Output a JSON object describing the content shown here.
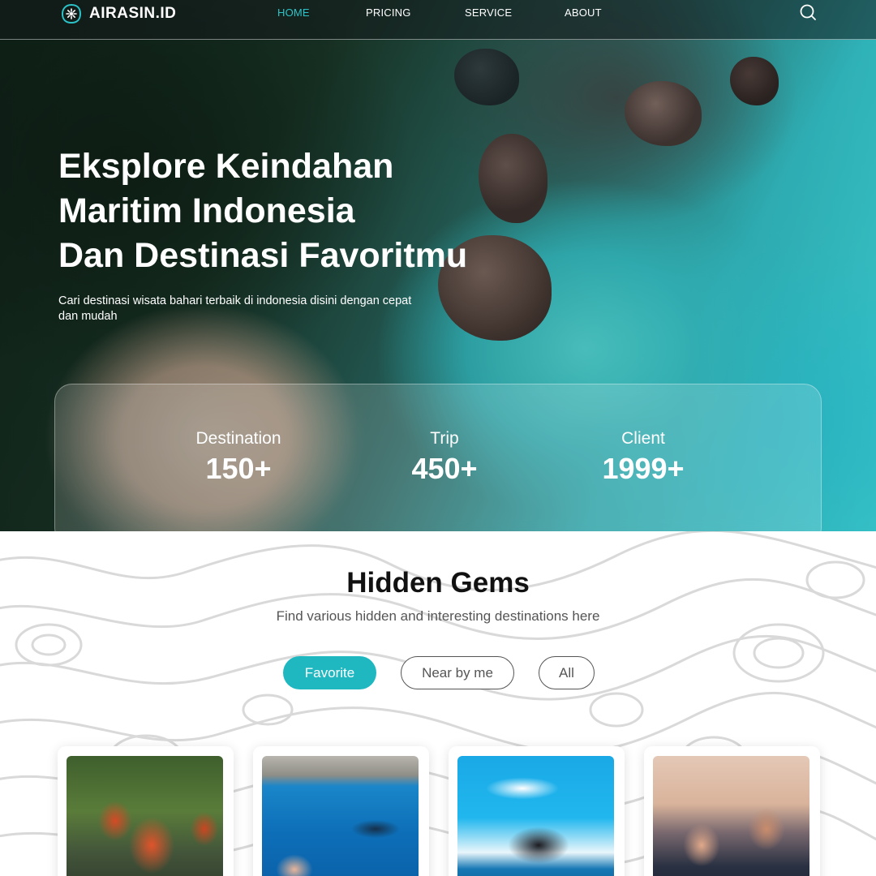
{
  "brand": {
    "name": "AIRASIN.ID",
    "accent": "#2cc4c9"
  },
  "nav": {
    "items": [
      {
        "label": "HOME",
        "active": true
      },
      {
        "label": "PRICING",
        "active": false
      },
      {
        "label": "SERVICE",
        "active": false
      },
      {
        "label": "ABOUT",
        "active": false
      }
    ],
    "search_icon": "search-icon"
  },
  "hero": {
    "title_lines": [
      "Eksplore Keindahan",
      "Maritim Indonesia",
      "Dan Destinasi Favoritmu"
    ],
    "subtitle": "Cari destinasi wisata bahari terbaik di indonesia disini dengan cepat dan mudah"
  },
  "stats": [
    {
      "label": "Destination",
      "value": "150+"
    },
    {
      "label": "Trip",
      "value": "450+"
    },
    {
      "label": "Client",
      "value": "1999+"
    }
  ],
  "gems": {
    "title": "Hidden Gems",
    "subtitle": "Find various hidden and interesting destinations here",
    "filters": [
      {
        "label": "Favorite",
        "active": true
      },
      {
        "label": "Near by me",
        "active": false
      },
      {
        "label": "All",
        "active": false
      }
    ],
    "pill_color": "#1fb8c1"
  }
}
